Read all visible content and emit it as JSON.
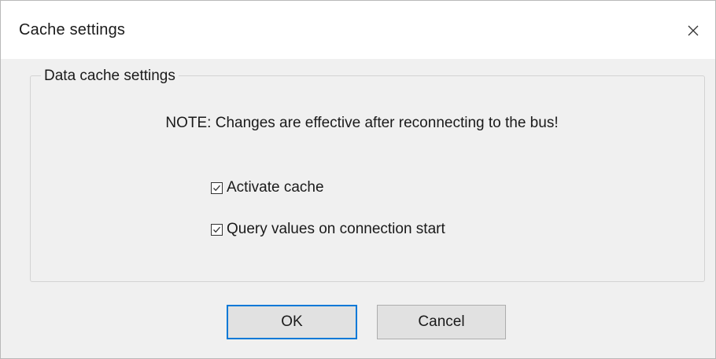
{
  "window": {
    "title": "Cache settings",
    "close_icon": "close-icon"
  },
  "group": {
    "legend": "Data cache settings",
    "note": "NOTE: Changes are effective after reconnecting to the bus!"
  },
  "options": [
    {
      "label": "Activate cache",
      "checked": true
    },
    {
      "label": "Query values on connection start",
      "checked": true
    }
  ],
  "buttons": {
    "ok_label": "OK",
    "cancel_label": "Cancel"
  },
  "colors": {
    "accent": "#0078d7",
    "background": "#f0f0f0",
    "titlebar": "#ffffff"
  }
}
